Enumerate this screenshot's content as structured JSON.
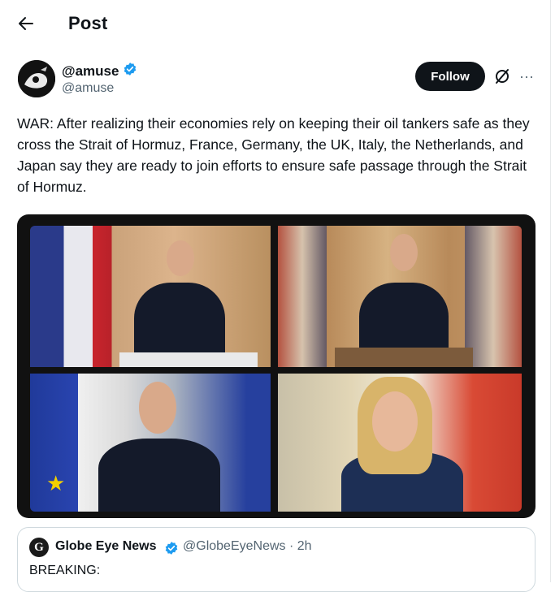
{
  "header": {
    "title": "Post"
  },
  "author": {
    "display_name": "@amuse",
    "handle": "@amuse",
    "verified_color": "#1d9bf0"
  },
  "actions": {
    "follow_label": "Follow",
    "more_label": "···"
  },
  "post": {
    "text": "WAR: After realizing their economies rely on keeping their oil tankers safe as they cross the Strait of Hormuz, France, Germany, the UK, Italy, the Netherlands, and Japan say they are ready to join efforts to ensure safe passage through the Strait of Hormuz."
  },
  "media": {
    "panels": [
      "photo-leader-1",
      "photo-leader-2",
      "photo-leader-3",
      "photo-leader-4"
    ]
  },
  "quoted_post": {
    "avatar_letter": "G",
    "name": "Globe Eye News",
    "meta": "@GlobeEyeNews · 2h",
    "text": "BREAKING:"
  },
  "colors": {
    "text": "#0f1419",
    "secondary": "#536471",
    "accent": "#1d9bf0",
    "border": "#cfd9de"
  }
}
